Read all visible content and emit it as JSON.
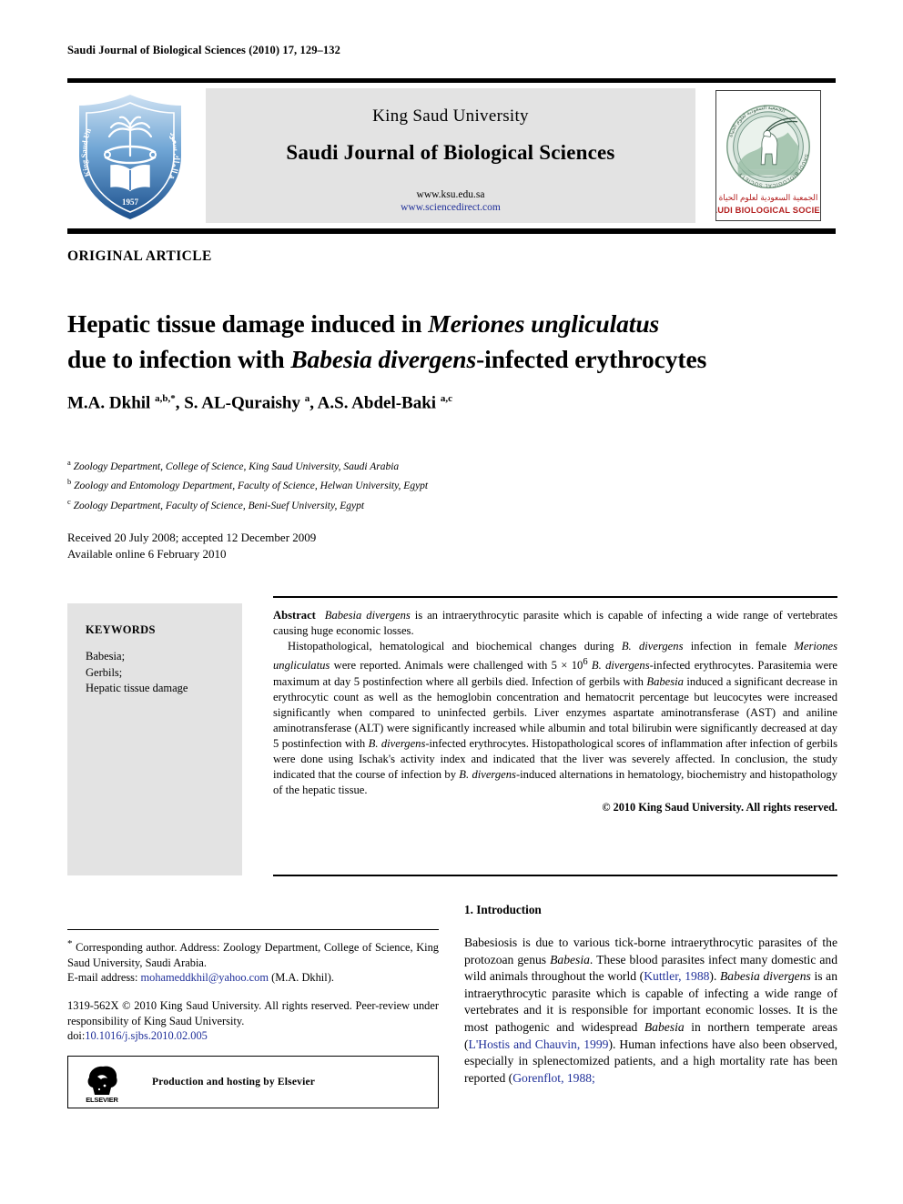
{
  "running_head": "Saudi Journal of Biological Sciences (2010) 17, 129–132",
  "banner": {
    "publisher": "King Saud University",
    "journal_title": "Saudi Journal of Biological Sciences",
    "url_ksu": "www.ksu.edu.sa",
    "url_sciencedirect": "www.sciencedirect.com",
    "left_logo_name": "king-saud-university-logo",
    "right_logo_name": "saudi-biological-society-logo",
    "right_logo_arabic": "الجمعية السعودية لعلوم الحياة",
    "right_logo_caption": "SAUDI BIOLOGICAL SOCIETY"
  },
  "article_type": "ORIGINAL ARTICLE",
  "title": {
    "line1_a": "Hepatic tissue damage induced in ",
    "line1_i": "Meriones ungliculatus",
    "line2_a": "due to infection with ",
    "line2_i": "Babesia divergens",
    "line2_b": "-infected erythrocytes"
  },
  "authors": {
    "a1_name": "M.A. Dkhil ",
    "a1_sup": "a,b,*",
    "a2_name": ", S. AL-Quraishy ",
    "a2_sup": "a",
    "a3_name": ", A.S. Abdel-Baki ",
    "a3_sup": "a,c"
  },
  "affiliations": [
    {
      "mark": "a",
      "text": "Zoology Department, College of Science, King Saud University, Saudi Arabia"
    },
    {
      "mark": "b",
      "text": "Zoology and Entomology Department, Faculty of Science, Helwan University, Egypt"
    },
    {
      "mark": "c",
      "text": "Zoology Department, Faculty of Science, Beni-Suef University, Egypt"
    }
  ],
  "history": {
    "line1": "Received 20 July 2008; accepted 12 December 2009",
    "line2": "Available online 6 February 2010"
  },
  "keywords": {
    "heading": "KEYWORDS",
    "items": [
      "Babesia;",
      "Gerbils;",
      "Hepatic tissue damage"
    ]
  },
  "abstract": {
    "label": "Abstract",
    "p1_i": "Babesia divergens",
    "p1_rest": " is an intraerythrocytic parasite which is capable of infecting a wide range of vertebrates causing huge economic losses.",
    "p2_s1": "Histopathological, hematological and biochemical changes during ",
    "p2_i1": "B. divergens",
    "p2_s2": " infection in female ",
    "p2_i2": "Meriones ungliculatus",
    "p2_s3": " were reported. Animals were challenged with 5 × 10",
    "p2_sup": "6",
    "p2_s4": " ",
    "p2_i3": "B. divergens",
    "p2_s5": "-infected erythrocytes. Parasitemia were maximum at day 5 postinfection where all gerbils died. Infection of gerbils with ",
    "p2_i4": "Babesia",
    "p2_s6": " induced a significant decrease in erythrocytic count as well as the hemoglobin concentration and hematocrit percentage but leucocytes were increased significantly when compared to uninfected gerbils. Liver enzymes aspartate aminotransferase (AST) and aniline aminotransferase (ALT) were significantly increased while albumin and total bilirubin were significantly decreased at day 5 postinfection with ",
    "p2_i5": "B. divergens",
    "p2_s7": "-infected erythrocytes. Histopathological scores of inflammation after infection of gerbils were done using Ischak's activity index and indicated that the liver was severely affected. In conclusion, the study indicated that the course of infection by ",
    "p2_i6": "B. divergens",
    "p2_s8": "-induced alternations in hematology, biochemistry and histopathology of the hepatic tissue.",
    "copyright": "© 2010 King Saud University. All rights reserved."
  },
  "footnote": {
    "mark": "*",
    "corresponding": " Corresponding author. Address: Zoology Department, College of Science, King Saud University, Saudi Arabia.",
    "email_label": "E-mail address: ",
    "email": "mohameddkhil@yahoo.com",
    "email_suffix": " (M.A. Dkhil).",
    "issn_line": "1319-562X © 2010 King Saud University. All rights reserved. Peer-review under responsibility of King Saud University.",
    "doi_label": "doi:",
    "doi": "10.1016/j.sjbs.2010.02.005"
  },
  "elsevier": {
    "caption": "Production and hosting by Elsevier",
    "wordmark": "ELSEVIER"
  },
  "section": {
    "heading": "1. Introduction",
    "p1_s1": "Babesiosis is due to various tick-borne intraerythrocytic parasites of the protozoan genus ",
    "p1_i1": "Babesia",
    "p1_s2": ". These blood parasites infect many domestic and wild animals throughout the world (",
    "p1_c1": "Kuttler, 1988",
    "p1_s3": "). ",
    "p1_i2": "Babesia divergens",
    "p1_s4": " is an intraerythrocytic parasite which is capable of infecting a wide range of vertebrates and it is responsible for important economic losses. It is the most pathogenic and widespread ",
    "p1_i3": "Babesia",
    "p1_s5": " in northern temperate areas (",
    "p1_c2": "L'Hostis and Chauvin, 1999",
    "p1_s6": "). Human infections have also been observed, especially in splenectomized patients, and a high mortality rate has been reported (",
    "p1_c3": "Gorenflot, 1988;"
  },
  "colors": {
    "link_blue": "#1f2f99",
    "banner_grey": "#e3e3e3",
    "logo_blue": "#2b6cb5",
    "sbs_red": "#b42020"
  }
}
